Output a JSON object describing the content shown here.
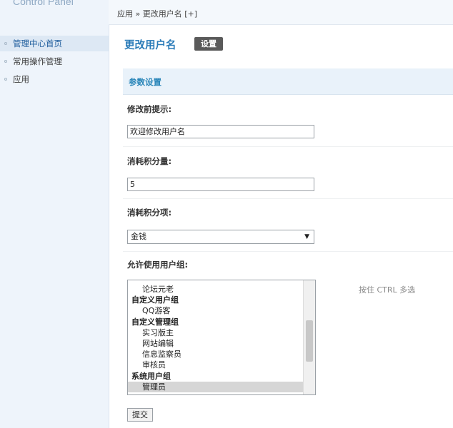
{
  "sidebar": {
    "title": "Control Panel",
    "items": [
      {
        "label": "管理中心首页"
      },
      {
        "label": "常用操作管理"
      },
      {
        "label": "应用"
      }
    ]
  },
  "breadcrumb": "应用 » 更改用户名 [+]",
  "page": {
    "title": "更改用户名",
    "settings_button": "设置"
  },
  "params": {
    "header": "参数设置",
    "hint_label": "修改前提示:",
    "hint_value": "欢迎修改用户名",
    "cost_label": "消耗积分量:",
    "cost_value": "5",
    "cost_item_label": "消耗积分项:",
    "cost_item_value": "金钱",
    "groups_label": "允许使用用户组:",
    "groups_hint": "按住 CTRL 多选",
    "groups": [
      {
        "label": "论坛元老",
        "type": "child"
      },
      {
        "label": "自定义用户组",
        "type": "group"
      },
      {
        "label": "QQ游客",
        "type": "child"
      },
      {
        "label": "自定义管理组",
        "type": "group"
      },
      {
        "label": "实习版主",
        "type": "child"
      },
      {
        "label": "网站编辑",
        "type": "child"
      },
      {
        "label": "信息监察员",
        "type": "child"
      },
      {
        "label": "审核员",
        "type": "child"
      },
      {
        "label": "系统用户组",
        "type": "group"
      },
      {
        "label": "管理员",
        "type": "child",
        "selected": true
      }
    ]
  },
  "submit_label": "提交"
}
